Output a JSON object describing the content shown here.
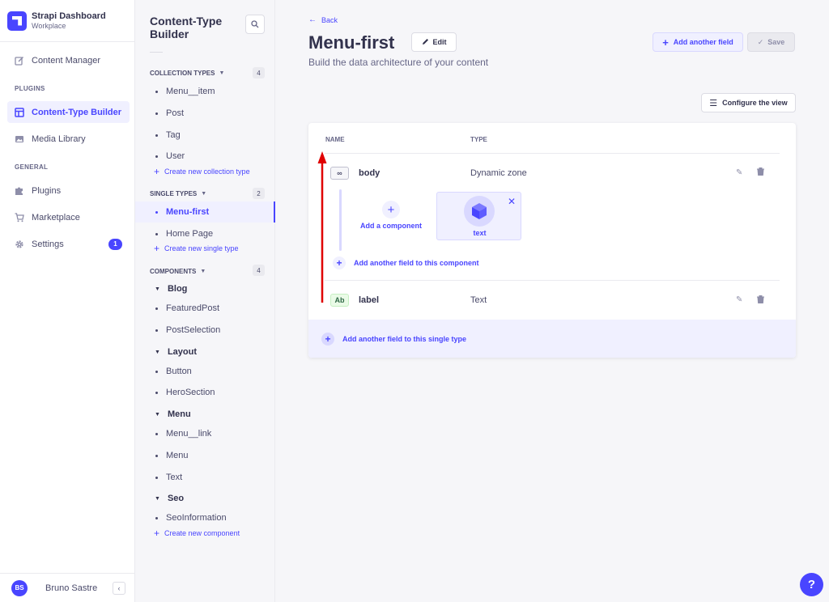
{
  "brand": {
    "title": "Strapi Dashboard",
    "subtitle": "Workplace"
  },
  "nav": {
    "content_manager": "Content Manager",
    "plugins_section": "PLUGINS",
    "content_type_builder": "Content-Type Builder",
    "media_library": "Media Library",
    "general_section": "GENERAL",
    "plugins": "Plugins",
    "marketplace": "Marketplace",
    "settings": "Settings",
    "settings_badge": "1"
  },
  "user": {
    "initials": "BS",
    "name": "Bruno Sastre"
  },
  "subnav": {
    "title": "Content-Type Builder",
    "collection_types": {
      "label": "COLLECTION TYPES",
      "count": "4",
      "items": [
        "Menu__item",
        "Post",
        "Tag",
        "User"
      ],
      "create": "Create new collection type"
    },
    "single_types": {
      "label": "SINGLE TYPES",
      "count": "2",
      "items": [
        "Menu-first",
        "Home Page"
      ],
      "create": "Create new single type"
    },
    "components": {
      "label": "COMPONENTS",
      "count": "4",
      "groups": [
        {
          "name": "Blog",
          "items": [
            "FeaturedPost",
            "PostSelection"
          ]
        },
        {
          "name": "Layout",
          "items": [
            "Button",
            "HeroSection"
          ]
        },
        {
          "name": "Menu",
          "items": [
            "Menu__link",
            "Menu",
            "Text"
          ]
        },
        {
          "name": "Seo",
          "items": [
            "SeoInformation"
          ]
        }
      ],
      "create": "Create new component"
    }
  },
  "header": {
    "back": "Back",
    "title": "Menu-first",
    "edit": "Edit",
    "subtitle": "Build the data architecture of your content",
    "add_field": "Add another field",
    "save": "Save",
    "configure": "Configure the view"
  },
  "table": {
    "col_name": "NAME",
    "col_type": "TYPE",
    "rows": [
      {
        "icon": "∞",
        "name": "body",
        "type": "Dynamic zone"
      },
      {
        "icon": "Ab",
        "name": "label",
        "type": "Text"
      }
    ],
    "add_component": "Add a component",
    "component_name": "text",
    "add_to_component": "Add another field to this component",
    "add_to_single": "Add another field to this single type"
  },
  "help": "?",
  "colors": {
    "accent": "#4945ff",
    "accent_light": "#f0f0ff",
    "arrow": "#e00000"
  }
}
